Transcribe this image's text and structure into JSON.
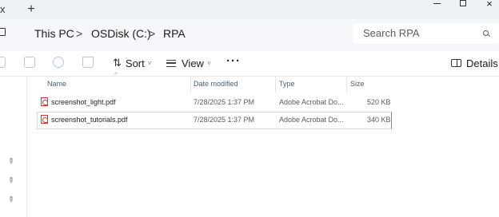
{
  "titlebar": {
    "close_glyph": "x",
    "new_tab_glyph": "+",
    "minimize_icon": "minimize-icon",
    "maximize_icon": "maximize-icon",
    "close_window_glyph": "×"
  },
  "breadcrumb": {
    "items": [
      "This PC",
      "OSDisk (C:)",
      "RPA"
    ],
    "separator": ">"
  },
  "search": {
    "placeholder": "Search RPA"
  },
  "toolbar": {
    "sort_label": "Sort",
    "sort_glyph": "⇅",
    "view_label": "View",
    "more_label": "···",
    "details_label": "Details",
    "chevron": "˅"
  },
  "columns": {
    "name": "Name",
    "date_modified": "Date modified",
    "type": "Type",
    "size": "Size"
  },
  "files": [
    {
      "name": "screenshot_light.pdf",
      "date_modified": "7/28/2025 1:37 PM",
      "type": "Adobe Acrobat Do...",
      "size": "520 KB"
    },
    {
      "name": "screenshot_tutorials.pdf",
      "date_modified": "7/28/2025 1:37 PM",
      "type": "Adobe Acrobat Do...",
      "size": "340 KB"
    }
  ],
  "nav": {
    "pin_glyph": "✎"
  },
  "colors": {
    "titlebar_bg": "#eef1f6",
    "addressbar_bg": "#f5f7fb",
    "pdf_red": "#dd3333",
    "header_text": "#4a5e7a"
  }
}
